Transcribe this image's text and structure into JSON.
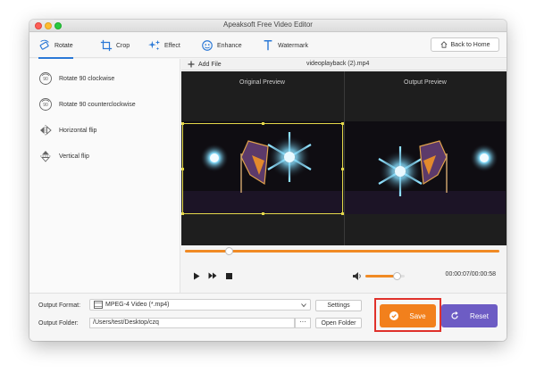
{
  "window": {
    "title": "Apeaksoft Free Video Editor"
  },
  "toolbar": {
    "tabs": [
      {
        "label": "Rotate",
        "icon": "rotate-icon"
      },
      {
        "label": "Crop",
        "icon": "crop-icon"
      },
      {
        "label": "Effect",
        "icon": "effect-icon"
      },
      {
        "label": "Enhance",
        "icon": "enhance-icon"
      },
      {
        "label": "Watermark",
        "icon": "watermark-icon"
      }
    ],
    "active_tab": "Rotate",
    "back_label": "Back to Home"
  },
  "operations": [
    {
      "label": "Rotate 90 clockwise",
      "icon": "rotate-cw-icon"
    },
    {
      "label": "Rotate 90 counterclockwise",
      "icon": "rotate-ccw-icon"
    },
    {
      "label": "Horizontal flip",
      "icon": "horizontal-flip-icon"
    },
    {
      "label": "Vertical flip",
      "icon": "vertical-flip-icon"
    }
  ],
  "file": {
    "add_label": "Add File",
    "name": "videoplayback (2).mp4"
  },
  "preview": {
    "original_label": "Original Preview",
    "output_label": "Output Preview"
  },
  "player": {
    "progress": 0.14,
    "volume": 0.8,
    "time": "00:00:07/00:00:58"
  },
  "output": {
    "format_label": "Output Format:",
    "format_value": "MPEG-4 Video (*.mp4)",
    "settings_label": "Settings",
    "folder_label": "Output Folder:",
    "folder_value": "/Users/test/Desktop/czq",
    "browse_label": "···",
    "open_folder_label": "Open Folder"
  },
  "actions": {
    "save_label": "Save",
    "reset_label": "Reset"
  },
  "colors": {
    "accent": "#f2801c",
    "reset": "#6d5cc4",
    "highlight": "#e0312b",
    "crop": "#e4d84a",
    "tab_underline": "#2a78d6"
  }
}
